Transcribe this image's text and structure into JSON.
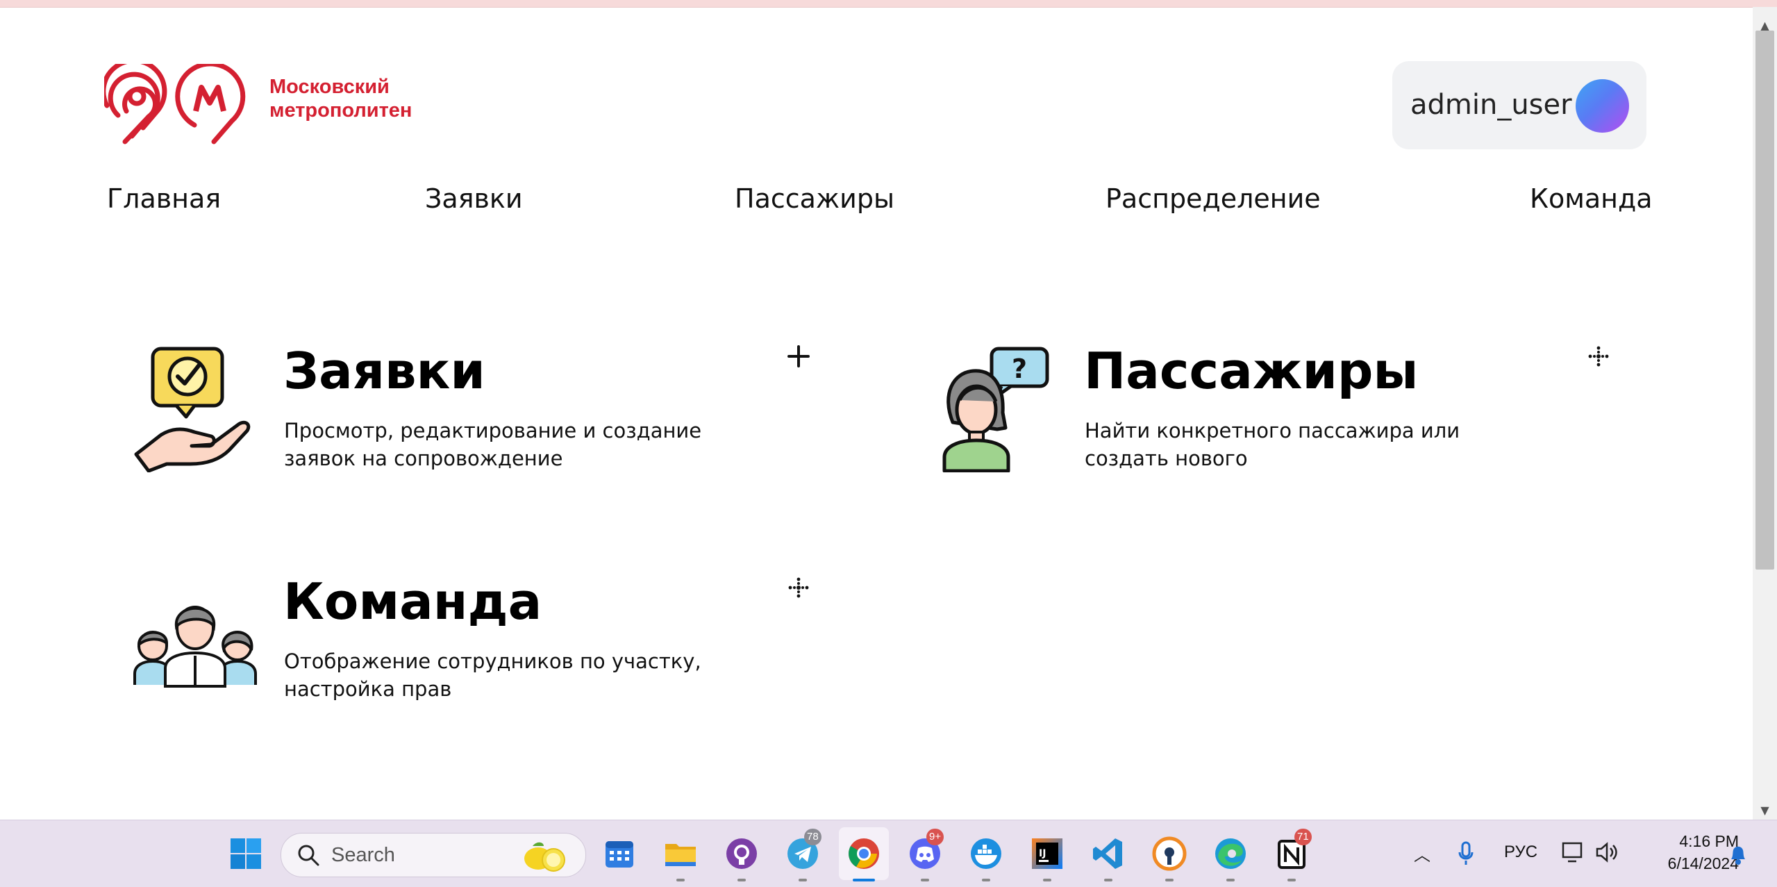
{
  "header": {
    "logo_text_line1": "Московский",
    "logo_text_line2": "метрополитен",
    "username": "admin_user"
  },
  "nav": {
    "items": [
      {
        "label": "Главная"
      },
      {
        "label": "Заявки"
      },
      {
        "label": "Пассажиры"
      },
      {
        "label": "Распределение"
      },
      {
        "label": "Команда"
      }
    ]
  },
  "cards": [
    {
      "title": "Заявки",
      "description": "Просмотр, редактирование и создание заявок на сопровождение",
      "action_icon": "plus-icon"
    },
    {
      "title": "Пассажиры",
      "description": "Найти конкретного пассажира или создать нового",
      "action_icon": "drag-move-icon"
    },
    {
      "title": "Команда",
      "description": "Отображение сотрудников по участку, настройка прав",
      "action_icon": "drag-move-icon"
    }
  ],
  "taskbar": {
    "search_placeholder": "Search",
    "telegram_badge": "78",
    "discord_badge": "9+",
    "notion_badge": "71",
    "language": "РУС",
    "time": "4:16 PM",
    "date": "6/14/2024"
  },
  "colors": {
    "brand_red": "#d42031",
    "avatar_gradient": [
      "#3ea5f3",
      "#b54cf0"
    ],
    "taskbar_bg": "#e8e0ee"
  }
}
